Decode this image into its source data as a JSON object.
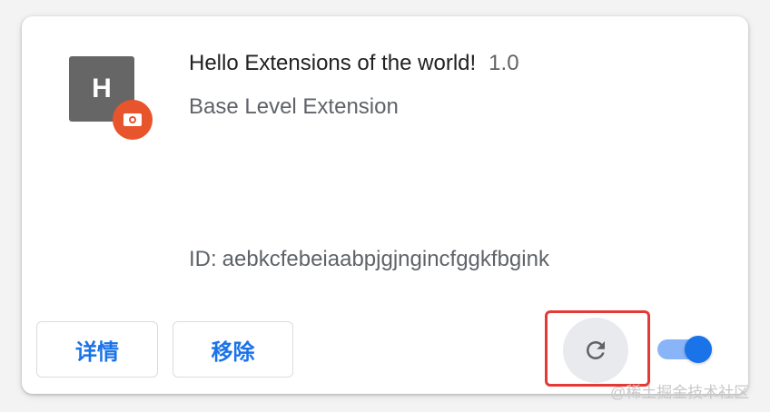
{
  "extension": {
    "icon_letter": "H",
    "name": "Hello Extensions of the world!",
    "version": "1.0",
    "description": "Base Level Extension",
    "id_label": "ID:",
    "id_value": "aebkcfebeiaabpjgjngincfggkfbgink"
  },
  "actions": {
    "details_label": "详情",
    "remove_label": "移除"
  },
  "toggle": {
    "enabled": true
  },
  "watermark": "@稀土掘金技术社区",
  "colors": {
    "accent": "#1a73e8",
    "icon_bg": "#666666",
    "badge": "#e8542b",
    "highlight": "#e53935"
  }
}
